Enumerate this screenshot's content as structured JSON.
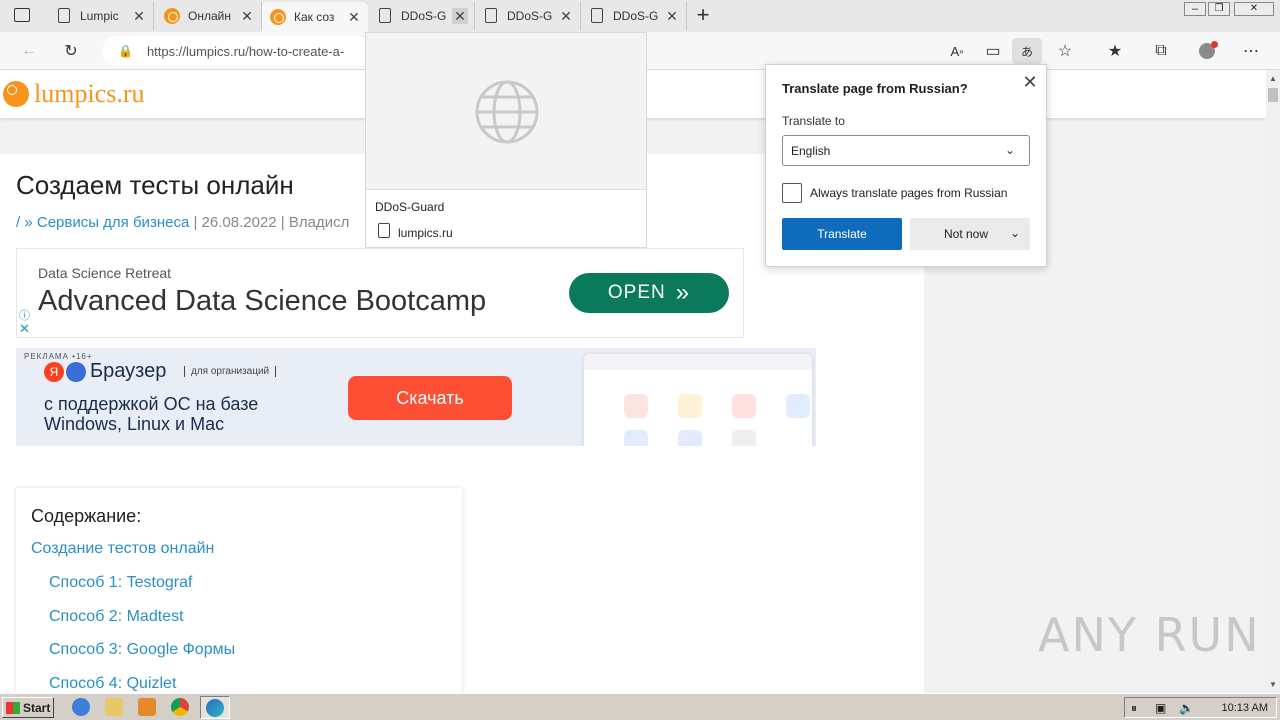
{
  "browser": {
    "tabs": [
      {
        "title": "Lumpic",
        "favicon": "document-icon"
      },
      {
        "title": "Онлайн",
        "favicon": "lumpics-orange-icon"
      },
      {
        "title": "Как соз",
        "favicon": "lumpics-orange-icon",
        "active": true
      },
      {
        "title": "DDoS-G",
        "favicon": "document-icon"
      },
      {
        "title": "DDoS-G",
        "favicon": "document-icon"
      },
      {
        "title": "DDoS-G",
        "favicon": "document-icon"
      }
    ],
    "new_tab_label": "+",
    "address": "https://lumpics.ru/how-to-create-a-",
    "window_buttons": [
      "–",
      "❐",
      "✕"
    ]
  },
  "hovercard": {
    "title": "DDoS-Guard",
    "url": "lumpics.ru"
  },
  "translate": {
    "title": "Translate page from Russian?",
    "translate_to_label": "Translate to",
    "language": "English",
    "always_label": "Always translate pages from Russian",
    "translate_button": "Translate",
    "not_now_button": "Not now"
  },
  "site": {
    "logo": "lumpics.ru",
    "article_title": "Создаем тесты онлайн",
    "meta_prefix": "/ » ",
    "meta_category": "Сервисы для бизнеса",
    "meta_rest": " | 26.08.2022 | Владисл"
  },
  "ad1": {
    "small": "Data Science Retreat",
    "big": "Advanced Data Science Bootcamp",
    "button": "OPEN"
  },
  "ad2": {
    "tag": "РЕКЛАМА •16+",
    "brand": "Браузер",
    "org": "для организаций",
    "line1": "с поддержкой ОС на базе",
    "line2": "Windows, Linux и Mac",
    "button": "Скачать"
  },
  "toc": {
    "title": "Содержание:",
    "items": [
      "Создание тестов онлайн",
      "Способ 1: Testograf",
      "Способ 2: Madtest",
      "Способ 3: Google Формы",
      "Способ 4: Quizlet"
    ]
  },
  "taskbar": {
    "start": "Start",
    "clock": "10:13 AM"
  },
  "watermark": "ANY RUN",
  "colors": {
    "accent": "#f7941d",
    "link": "#2b8fc7",
    "translate_button": "#0f6cbd",
    "ad_button": "#0b7a5a"
  }
}
